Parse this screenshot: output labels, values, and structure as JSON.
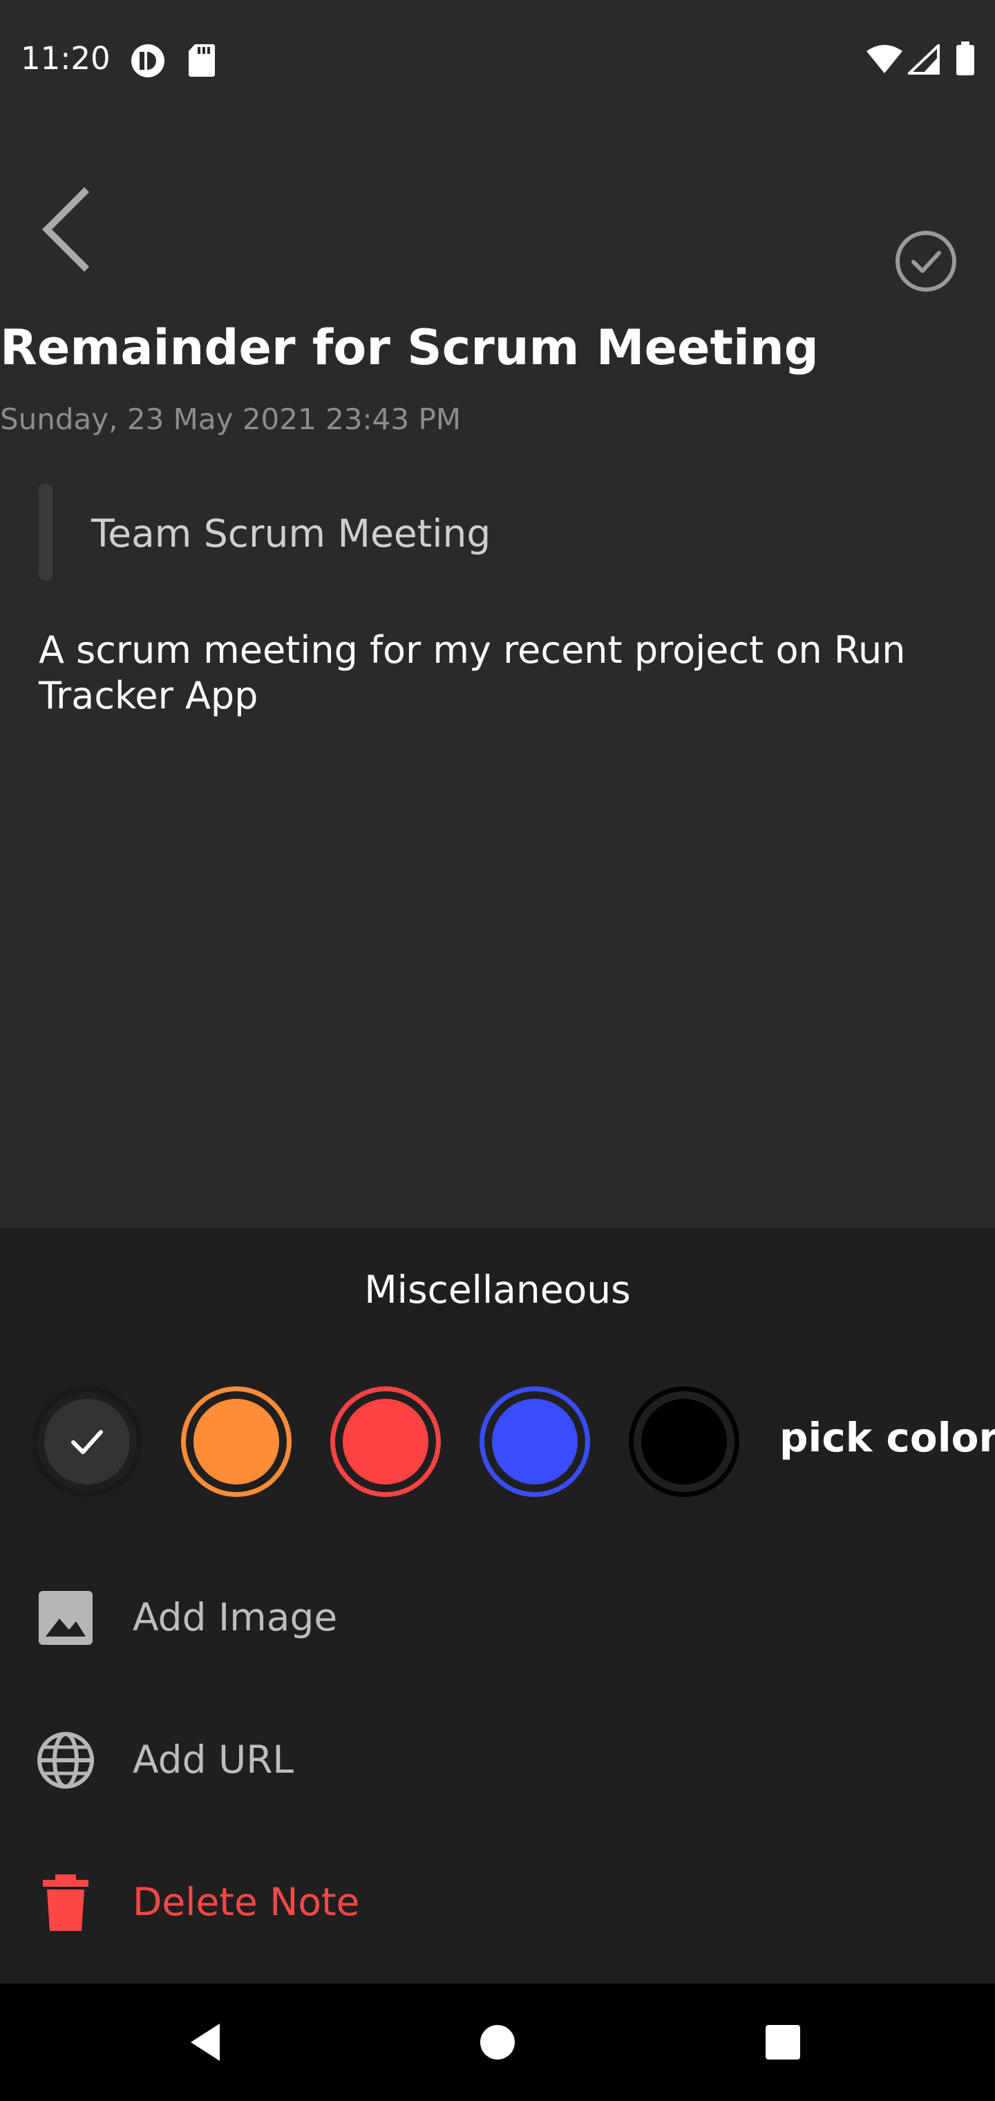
{
  "status_bar": {
    "time": "11:20",
    "icons": [
      "app-notification-icon",
      "sd-card-icon",
      "wifi-icon",
      "cellular-signal-icon",
      "battery-icon"
    ]
  },
  "header": {
    "back_icon": "chevron-left-icon",
    "done_icon": "check-circle-icon"
  },
  "note": {
    "title": "Remainder for Scrum Meeting",
    "datetime": "Sunday, 23 May 2021 23:43 PM",
    "subtitle": "Team Scrum Meeting",
    "body": "A scrum meeting for my recent project on Run Tracker App"
  },
  "misc_sheet": {
    "title": "Miscellaneous",
    "colors": [
      {
        "name": "default",
        "hex": "#333333",
        "selected": true
      },
      {
        "name": "orange",
        "hex": "#ff8c37",
        "selected": false
      },
      {
        "name": "red",
        "hex": "#ff4242",
        "selected": false
      },
      {
        "name": "blue",
        "hex": "#3a4dff",
        "selected": false
      },
      {
        "name": "black",
        "hex": "#000000",
        "selected": false
      }
    ],
    "pick_color_label": "pick color",
    "actions": [
      {
        "label": "Add Image",
        "icon": "image-icon"
      },
      {
        "label": "Add URL",
        "icon": "globe-icon"
      },
      {
        "label": "Delete Note",
        "icon": "trash-icon",
        "color": "#ff4747"
      }
    ]
  },
  "nav_bar": {
    "icons": [
      "back-triangle-icon",
      "home-circle-icon",
      "recents-square-icon"
    ]
  }
}
